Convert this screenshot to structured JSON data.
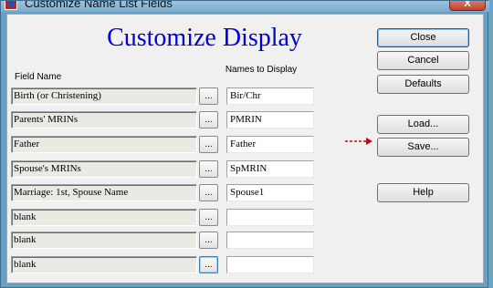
{
  "window": {
    "title": "Customize Name List Fields",
    "close_glyph": "X"
  },
  "heading": "Customize Display",
  "columns": {
    "field_name": "Field Name",
    "names_to_display": "Names to Display"
  },
  "rows": [
    {
      "field": "Birth (or Christening)",
      "pick": "...",
      "display": "Bir/Chr"
    },
    {
      "field": "Parents' MRINs",
      "pick": "...",
      "display": "PMRIN"
    },
    {
      "field": "Father",
      "pick": "...",
      "display": "Father"
    },
    {
      "field": "Spouse's MRINs",
      "pick": "...",
      "display": "SpMRIN"
    },
    {
      "field": "Marriage: 1st, Spouse Name",
      "pick": "...",
      "display": "Spouse1"
    },
    {
      "field": "blank",
      "pick": "...",
      "display": ""
    },
    {
      "field": "blank",
      "pick": "...",
      "display": ""
    },
    {
      "field": "blank",
      "pick": "...",
      "display": ""
    }
  ],
  "buttons": {
    "close": "Close",
    "cancel": "Cancel",
    "defaults": "Defaults",
    "load": "Load...",
    "save": "Save...",
    "help": "Help"
  },
  "colors": {
    "heading": "#0000dd",
    "arrow": "#d40000"
  }
}
